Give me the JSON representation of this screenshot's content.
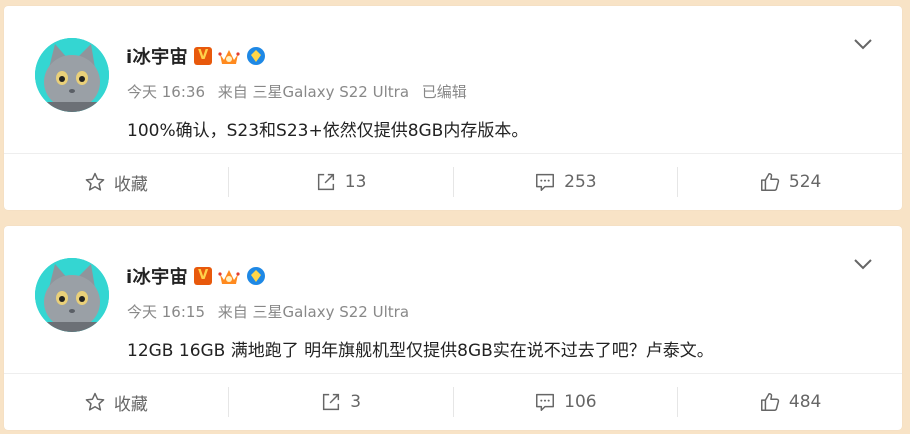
{
  "posts": [
    {
      "user": "i冰宇宙",
      "time": "今天 16:36",
      "source": "来自 三星Galaxy S22 Ultra",
      "edited": "已编辑",
      "text": "100%确认，S23和S23+依然仅提供8GB内存版本。",
      "actions": {
        "favorite": "收藏",
        "repost": "13",
        "comment": "253",
        "like": "524"
      }
    },
    {
      "user": "i冰宇宙",
      "time": "今天 16:15",
      "source": "来自 三星Galaxy S22 Ultra",
      "text": "12GB 16GB 满地跑了 明年旗舰机型仅提供8GB实在说不过去了吧？卢泰文。",
      "actions": {
        "favorite": "收藏",
        "repost": "3",
        "comment": "106",
        "like": "484"
      }
    }
  ],
  "badges": {
    "verified_letter": "V"
  },
  "icons": [
    "chevron-down-icon",
    "star-icon",
    "repost-icon",
    "comment-icon",
    "like-icon",
    "crown-badge-icon",
    "diamond-badge-icon"
  ],
  "colors": {
    "page_bg": "#f8e3c6",
    "card_bg": "#ffffff",
    "verified": "#e8590c",
    "avatar_bg": "#34d6d2"
  }
}
